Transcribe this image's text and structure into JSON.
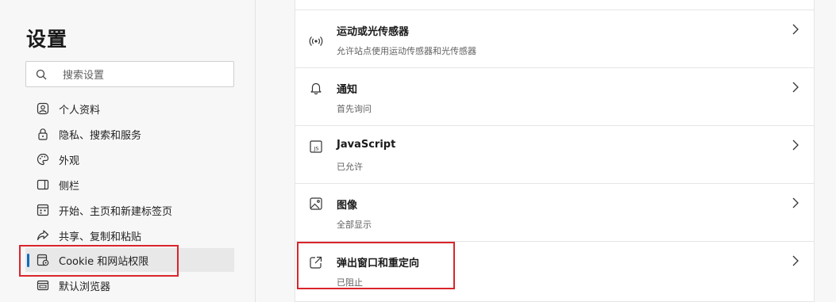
{
  "sidebar": {
    "title": "设置",
    "search_placeholder": "搜索设置",
    "items": [
      {
        "label": "个人资料",
        "icon": "profile-icon"
      },
      {
        "label": "隐私、搜索和服务",
        "icon": "lock-icon"
      },
      {
        "label": "外观",
        "icon": "palette-icon"
      },
      {
        "label": "侧栏",
        "icon": "sidebar-icon"
      },
      {
        "label": "开始、主页和新建标签页",
        "icon": "home-grid-icon"
      },
      {
        "label": "共享、复制和粘贴",
        "icon": "share-icon"
      },
      {
        "label": "Cookie 和网站权限",
        "icon": "cookie-site-icon",
        "active": true
      },
      {
        "label": "默认浏览器",
        "icon": "browser-icon"
      }
    ]
  },
  "permissions": [
    {
      "title": "运动或光传感器",
      "description": "允许站点使用运动传感器和光传感器",
      "icon": "sensor-icon"
    },
    {
      "title": "通知",
      "description": "首先询问",
      "icon": "bell-icon"
    },
    {
      "title": "JavaScript",
      "description": "已允许",
      "icon": "js-icon"
    },
    {
      "title": "图像",
      "description": "全部显示",
      "icon": "image-icon"
    },
    {
      "title": "弹出窗口和重定向",
      "description": "已阻止",
      "icon": "popup-icon"
    }
  ],
  "colors": {
    "accent": "#0f6cbd",
    "highlight": "#d9252b",
    "background": "#f7f7f7",
    "panel": "#ffffff"
  }
}
